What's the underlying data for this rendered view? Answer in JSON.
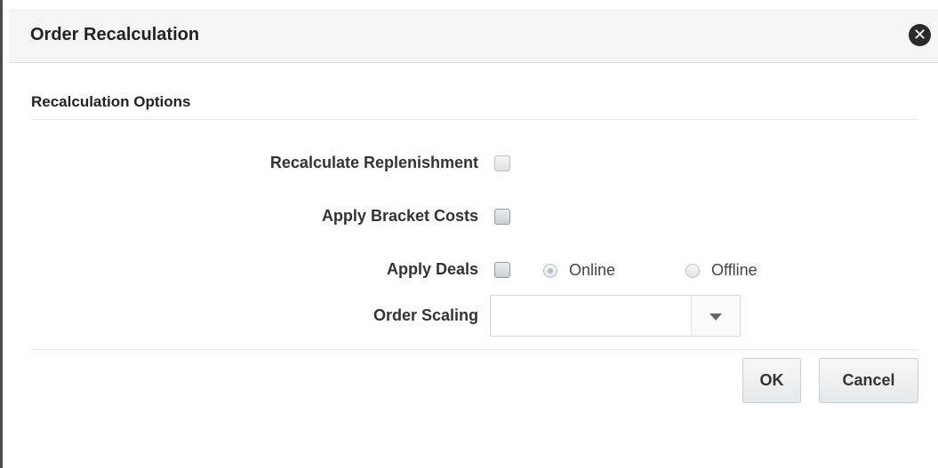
{
  "dialog": {
    "title": "Order Recalculation",
    "close_icon": "close-icon"
  },
  "section": {
    "title": "Recalculation Options"
  },
  "fields": {
    "recalculate_replenishment": {
      "label": "Recalculate Replenishment",
      "checked": false
    },
    "apply_bracket_costs": {
      "label": "Apply Bracket Costs",
      "checked": false
    },
    "apply_deals": {
      "label": "Apply Deals",
      "checked": false
    },
    "deal_mode": {
      "options": [
        "Online",
        "Offline"
      ],
      "selected": "Online"
    },
    "order_scaling": {
      "label": "Order Scaling",
      "value": ""
    }
  },
  "buttons": {
    "ok": "OK",
    "cancel": "Cancel"
  },
  "colors": {
    "header_bg": "#f3f5f7",
    "close_icon": "#2a2a2a"
  }
}
